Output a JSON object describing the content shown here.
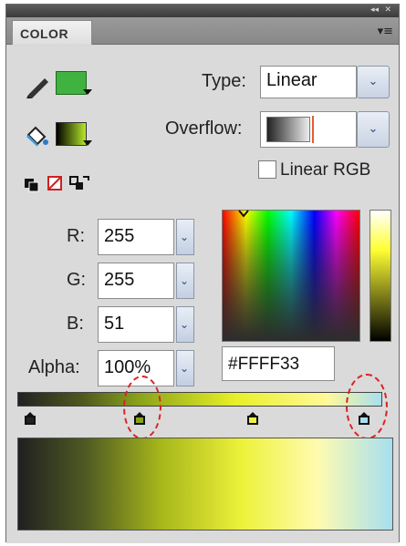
{
  "panel": {
    "tab_label": "COLOR"
  },
  "type": {
    "label": "Type:",
    "value": "Linear"
  },
  "overflow": {
    "label": "Overflow:"
  },
  "linear_rgb": {
    "label": "Linear RGB",
    "checked": false
  },
  "rgb": {
    "r": {
      "label": "R:",
      "value": "255"
    },
    "g": {
      "label": "G:",
      "value": "255"
    },
    "b": {
      "label": "B:",
      "value": "51"
    },
    "alpha": {
      "label": "Alpha:",
      "value": "100%"
    }
  },
  "hex": {
    "value": "#FFFF33"
  },
  "colors": {
    "stroke": "#3fb23f",
    "fill_gradient_start": "#000000",
    "fill_gradient_end": "#b6e82a",
    "current": "#ffff33"
  },
  "gradient_stops": [
    {
      "color": "#222222"
    },
    {
      "color": "#8aa21a"
    },
    {
      "color": "#eef23a"
    },
    {
      "color": "#a8dff0"
    }
  ]
}
